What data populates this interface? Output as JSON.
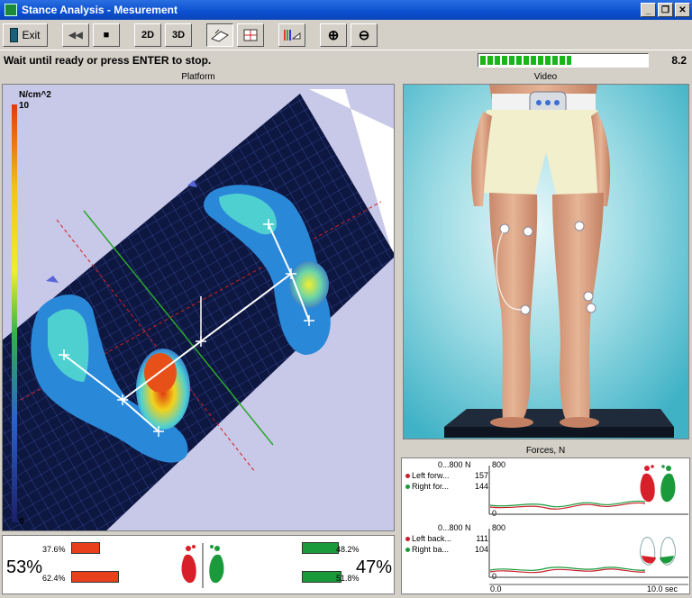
{
  "window": {
    "title": "Stance Analysis - Mesurement",
    "minimize": "_",
    "restore": "❐",
    "close": "✕"
  },
  "toolbar": {
    "exit_label": "Exit",
    "rewind": "◀◀",
    "stop": "■",
    "view_2d": "2D",
    "view_3d": "3D",
    "zoom_in": "⊕",
    "zoom_out": "⊖"
  },
  "status": {
    "message": "Wait until ready or press ENTER to stop.",
    "progress": 0.55,
    "time": "8.2"
  },
  "platform": {
    "title": "Platform",
    "unit": "N/cm^2",
    "scale_max": "10",
    "scale_min": "0"
  },
  "video": {
    "title": "Video"
  },
  "forces": {
    "title": "Forces, N",
    "top": {
      "range": "0...800 N",
      "ymax": "800",
      "ymin": "0",
      "rows": [
        {
          "label": "Left forw...",
          "value": "157",
          "color": "#c8202a"
        },
        {
          "label": "Right for...",
          "value": "144",
          "color": "#1a9a3a"
        }
      ]
    },
    "bottom": {
      "range": "0...800 N",
      "ymax": "800",
      "ymin": "0",
      "rows": [
        {
          "label": "Left back...",
          "value": "111",
          "color": "#c8202a"
        },
        {
          "label": "Right ba...",
          "value": "104",
          "color": "#1a9a3a"
        }
      ]
    },
    "x_start": "0.0",
    "x_end": "10.0 sec"
  },
  "balance": {
    "left_total": "53%",
    "right_total": "47%",
    "left_forward": "37.6%",
    "left_back": "62.4%",
    "right_forward": "48.2%",
    "right_back": "51.8%",
    "left_color": "#e8401c",
    "right_color": "#1a9a3a"
  }
}
